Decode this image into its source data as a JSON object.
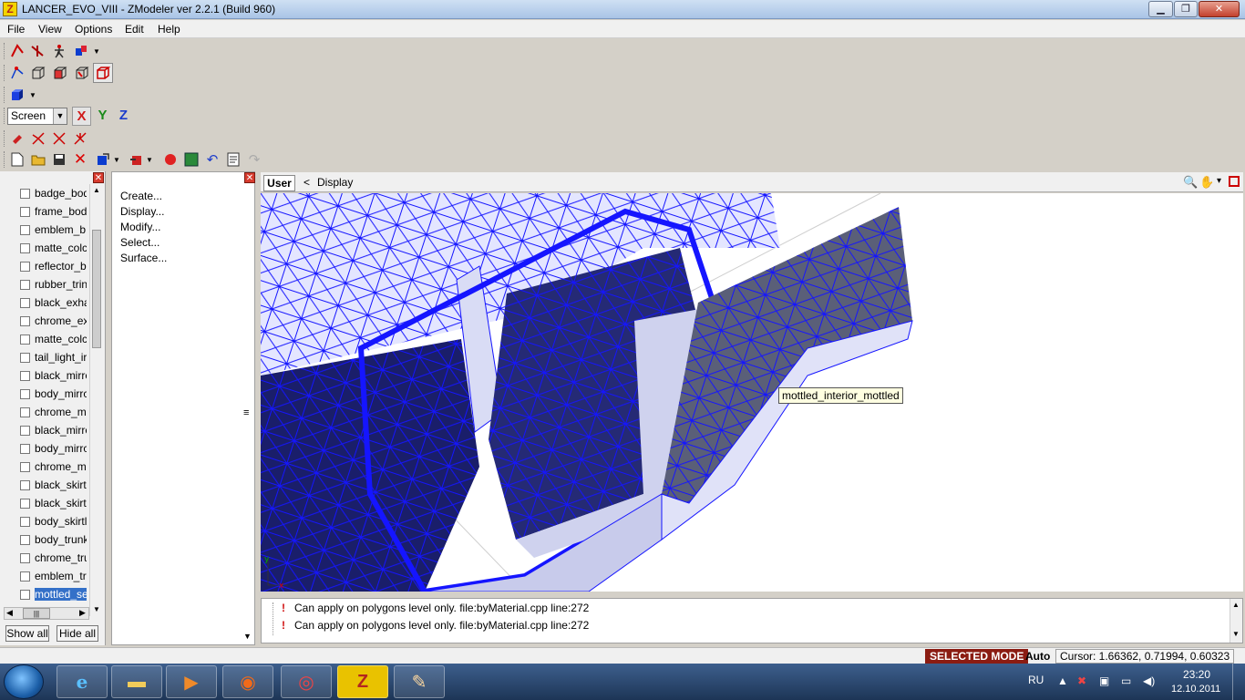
{
  "window": {
    "title": "LANCER_EVO_VIII - ZModeler ver 2.2.1 (Build 960)",
    "min_icon": "minimize-icon",
    "max_icon": "maximize-icon",
    "close_label": "✕"
  },
  "menu": [
    "File",
    "View",
    "Options",
    "Edit",
    "Help"
  ],
  "toolbar": {
    "space_select": "Screen",
    "axes": [
      "X",
      "Y",
      "Z"
    ],
    "axis_colors": {
      "x": "#d01c1c",
      "y": "#1a8a1a",
      "z": "#1c3ccc"
    }
  },
  "objects": {
    "items": [
      "badge_bod",
      "frame_bod",
      "emblem_b",
      "matte_colc",
      "reflector_b",
      "rubber_trin",
      "black_exha",
      "chrome_ex",
      "matte_colc",
      "tail_light_ir",
      "black_mirrc",
      "body_mirrc",
      "chrome_m",
      "black_mirrc",
      "body_mirrc",
      "chrome_m",
      "black_skirtl",
      "black_skirtl",
      "body_skirtl",
      "body_trunk",
      "chrome_tru",
      "emblem_tr",
      "mottled_se"
    ],
    "scroll_label": "|||",
    "show_all": "Show all",
    "hide_all": "Hide all"
  },
  "commands": [
    "Create...",
    "Display...",
    "Modify...",
    "Select...",
    "Surface..."
  ],
  "viewport": {
    "tab": "User",
    "breadcrumb": "<",
    "mode": "Display",
    "tooltip": "mottled_interior_mottled"
  },
  "log": [
    "Can apply on polygons level only. file:byMaterial.cpp line:272",
    "Can apply on polygons level only. file:byMaterial.cpp line:272"
  ],
  "status": {
    "mode": "SELECTED MODE",
    "auto": "Auto",
    "cursor": "Cursor: 1.66362, 0.71994, 0.60323"
  },
  "taskbar": {
    "lang": "RU",
    "time": "23:20",
    "date": "12.10.2011",
    "apps": [
      "ie-icon",
      "explorer-icon",
      "media-player-icon",
      "origin-icon",
      "chrome-icon",
      "zmodeler-icon",
      "paint-icon"
    ]
  }
}
